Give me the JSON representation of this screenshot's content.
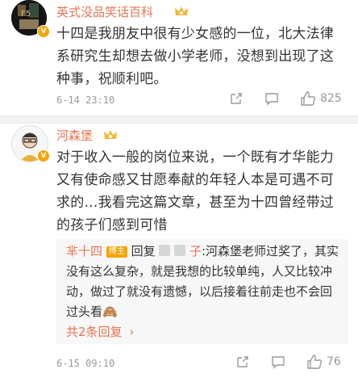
{
  "comments": [
    {
      "username": "英式没品笑话百科",
      "text": "十四是我朋友中很有少女感的一位，北大法律系研究生却想去做小学老师，没想到出现了这种事，祝顺利吧。",
      "time": "6-14 23:10",
      "likes": "825"
    },
    {
      "username": "河森堡",
      "text": "对于收入一般的岗位来说，一个既有才华能力又有使命感又甘愿奉献的年轻人本是可遇不可求的…我看完这篇文章，甚至为十四曾经带过的孩子们感到可惜",
      "time": "6-15 09:10",
      "likes": "76",
      "reply": {
        "username": "芈十四",
        "role_badge": "博主",
        "reply_word": "回复",
        "target_suffix": "子",
        "text": ":河森堡老师过奖了，其实没有这么复杂，就是我想的比较单纯，人又比较冲动，做过了就没有遗憾，以后接着往前走也不会回过头看",
        "emoji": "🙈",
        "more_label": "共2条回复",
        "more_arrow": "›"
      }
    }
  ],
  "icons": {
    "vip_badge": "crown-icon",
    "verified": "v-icon",
    "share": "share-icon",
    "comment": "comment-icon",
    "like": "thumbs-up-icon"
  },
  "colors": {
    "username": "#eb7350",
    "meta": "#999999",
    "reply_bg": "#f7f7f7"
  }
}
